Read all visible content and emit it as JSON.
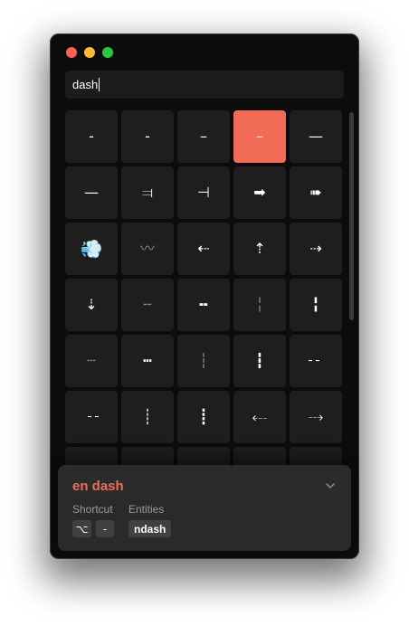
{
  "search": {
    "query": "dash"
  },
  "grid": {
    "cells": [
      "-",
      "-",
      "–",
      "–",
      "—",
      "—",
      "⫤",
      "⊣",
      "➡",
      "➠",
      "💨",
      "〰",
      "⇠",
      "⇡",
      "⇢",
      "⇣",
      "╌",
      "╍",
      "╎",
      "╏",
      "┄",
      "┅",
      "┆",
      "┇",
      "╴╴",
      "╶╶",
      "┊",
      "┋",
      "⤎",
      "⤏",
      "",
      "",
      "",
      "",
      ""
    ],
    "selected_index": 3
  },
  "detail": {
    "name": "en dash",
    "shortcut_label": "Shortcut",
    "entities_label": "Entities",
    "shortcut_keys": [
      "⌥",
      "-"
    ],
    "entity": "ndash",
    "expand_icon": "chevron-down-icon"
  },
  "colors": {
    "accent": "#f26b57",
    "window_bg": "#0c0c0c",
    "cell_bg": "#1e1e1e",
    "panel_bg": "#2c2c2c"
  }
}
